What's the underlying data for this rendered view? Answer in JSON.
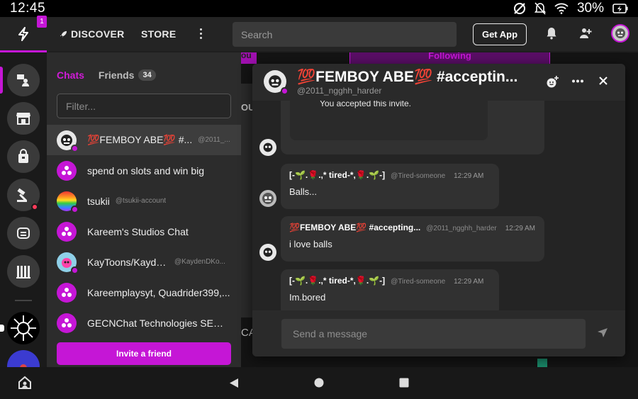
{
  "status_bar": {
    "time": "12:45",
    "battery": "30%"
  },
  "topnav": {
    "notification_count": "1",
    "discover_label": "DISCOVER",
    "store_label": "STORE",
    "search_placeholder": "Search",
    "get_app_label": "Get App"
  },
  "chat_panel": {
    "tab_chats": "Chats",
    "tab_friends": "Friends",
    "friends_count": "34",
    "filter_placeholder": "Filter...",
    "invite_label": "Invite a friend",
    "chats": [
      {
        "name": "💯FEMBOY ABE💯 #...",
        "handle": "@2011_..."
      },
      {
        "name": "spend on slots and win big",
        "handle": ""
      },
      {
        "name": "tsukii",
        "handle": "@tsukii-account"
      },
      {
        "name": "Kareem's Studios Chat",
        "handle": ""
      },
      {
        "name": "KayToons/Kayde...",
        "handle": "@KaydenDKo..."
      },
      {
        "name": "Kareemplaysyt, Quadrider399,...",
        "handle": ""
      },
      {
        "name": "GECNChat Technologies SEQ...",
        "handle": ""
      }
    ]
  },
  "background_page": {
    "tab_left": "ou",
    "tab_following": "Following",
    "fragment_ou": "OU",
    "fragment_ca": "CA"
  },
  "popup": {
    "title": "💯FEMBOY ABE💯 #acceptin...",
    "handle": "@2011_ngghh_harder",
    "invite_notice": "You accepted this invite.",
    "message_placeholder": "Send a message",
    "messages": [
      {
        "name": "[-🌱.🌹.,* tired-*,🌹.🌱-]",
        "handle": "@Tired-someone",
        "time": "12:29 AM",
        "text": "Balls..."
      },
      {
        "name": "💯FEMBOY ABE💯 #accepting...",
        "handle": "@2011_ngghh_harder",
        "time": "12:29 AM",
        "text": "i love balls"
      },
      {
        "name": "[-🌱.🌹.,* tired-*,🌹.🌱-]",
        "handle": "@Tired-someone",
        "time": "12:29 AM",
        "text": "Im.bored"
      }
    ]
  },
  "colors": {
    "accent": "#c516d6",
    "alert": "#ff3b5a"
  }
}
